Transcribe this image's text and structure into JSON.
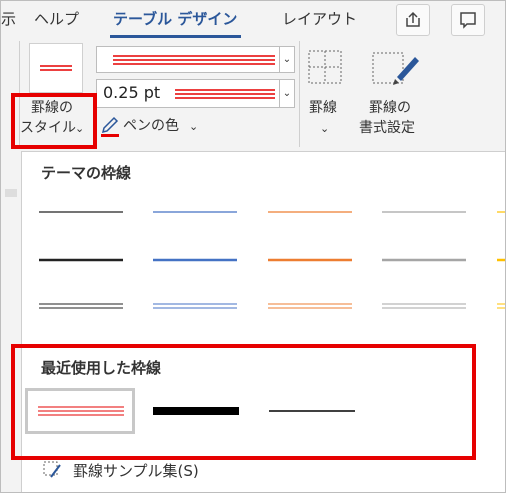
{
  "tabs": {
    "partial_left": "示",
    "help": "ヘルプ",
    "table_design": "テーブル デザイン",
    "layout": "レイアウト"
  },
  "ribbon": {
    "pen_weight": "0.25 pt",
    "border_style_label_line1": "罫線の",
    "border_style_label_line2": "スタイル",
    "pen_color_label": "ペンの色",
    "borders_label": "罫線",
    "border_format_label_line1": "罫線の",
    "border_format_label_line2": "書式設定"
  },
  "panel": {
    "theme_title": "テーマの枠線",
    "recent_title": "最近使用した枠線",
    "sample_menu": "罫線サンプル集(S)"
  },
  "colors": {
    "accent_blue": "#2b579a",
    "highlight_red": "#e60000",
    "pen_red": "#e60000"
  }
}
